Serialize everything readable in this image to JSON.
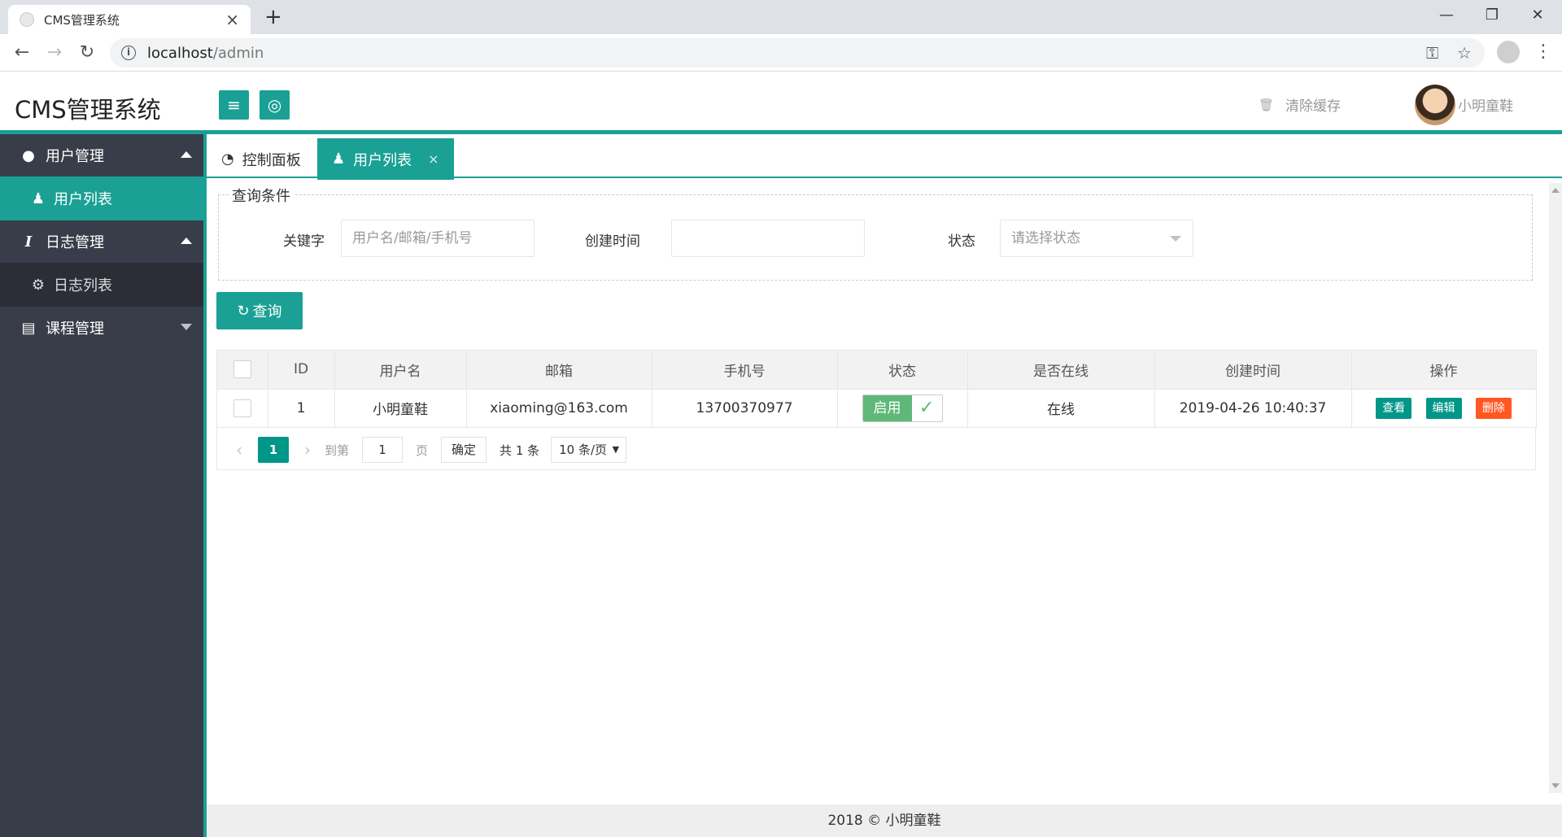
{
  "browser": {
    "tab_title": "CMS管理系统",
    "tab_close": "×",
    "new_tab": "+",
    "url_host": "localhost",
    "url_path": "/admin",
    "win_min": "—",
    "win_restore": "❐",
    "win_close": "✕"
  },
  "header": {
    "logo": "CMS管理系统",
    "clear_cache": "清除缓存",
    "username": "小明童鞋"
  },
  "sidebar": {
    "groups": [
      {
        "label": "用户管理",
        "icon": "users-icon",
        "items": [
          {
            "label": "用户列表",
            "icon": "user-icon"
          }
        ]
      },
      {
        "label": "日志管理",
        "icon": "italic-icon",
        "items": [
          {
            "label": "日志列表",
            "icon": "gear-icon"
          }
        ]
      },
      {
        "label": "课程管理",
        "icon": "table-icon",
        "items": []
      }
    ]
  },
  "tabs": [
    {
      "label": "控制面板",
      "icon": "dashboard-icon"
    },
    {
      "label": "用户列表",
      "icon": "user-icon",
      "close": "×"
    }
  ],
  "search": {
    "legend": "查询条件",
    "keyword_label": "关键字",
    "keyword_placeholder": "用户名/邮箱/手机号",
    "created_label": "创建时间",
    "created_value": "",
    "status_label": "状态",
    "status_placeholder": "请选择状态",
    "query_button": "查询"
  },
  "table": {
    "headers": [
      "ID",
      "用户名",
      "邮箱",
      "手机号",
      "状态",
      "是否在线",
      "创建时间",
      "操作"
    ],
    "rows": [
      {
        "id": "1",
        "username": "小明童鞋",
        "email": "xiaoming@163.com",
        "phone": "13700370977",
        "status": "启用",
        "online": "在线",
        "created": "2019-04-26 10:40:37",
        "actions": [
          "查看",
          "编辑",
          "删除"
        ]
      }
    ]
  },
  "pager": {
    "current": "1",
    "goto_label": "到第",
    "goto_value": "1",
    "page_unit": "页",
    "confirm": "确定",
    "total": "共 1 条",
    "page_size": "10 条/页"
  },
  "footer": "2018 © 小明童鞋"
}
